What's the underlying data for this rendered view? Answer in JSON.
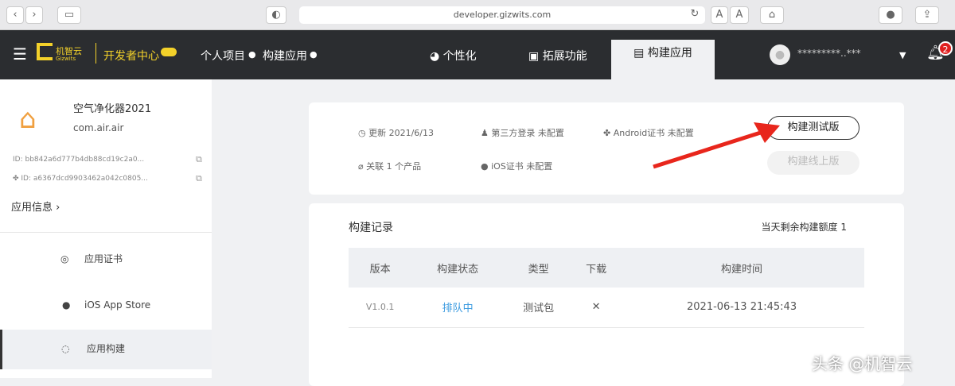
{
  "browser": {
    "url": "developer.gizwits.com",
    "font_small": "A",
    "font_large": "A"
  },
  "nav": {
    "brand": "机智云",
    "brand_sub": "Gizwits",
    "section": "开发者中心",
    "breadcrumb": [
      "个人项目",
      "构建应用"
    ],
    "tabs": [
      {
        "label": "个性化"
      },
      {
        "label": "拓展功能"
      },
      {
        "label": "构建应用"
      }
    ],
    "user": "*********..***",
    "notifications": "2"
  },
  "app": {
    "name": "空气净化器2021",
    "package": "com.air.air",
    "ios_id": "ID: bb842a6d777b4db88cd19c2a0...",
    "android_id": "ID: a6367dcd9903462a042c0805...",
    "info_link": "应用信息"
  },
  "sidebar": {
    "items": [
      {
        "label": "应用证书"
      },
      {
        "label": "iOS App Store"
      },
      {
        "label": "应用构建"
      }
    ]
  },
  "summary": {
    "updated": "更新 2021/6/13",
    "third_party": "第三方登录 未配置",
    "android_cert": "Android证书 未配置",
    "related": "关联 1 个产品",
    "ios_cert": "iOS证书 未配置",
    "build_test": "构建测试版",
    "build_release": "构建线上版"
  },
  "records": {
    "title": "构建记录",
    "quota": "当天剩余构建额度 1",
    "columns": [
      "版本",
      "构建状态",
      "类型",
      "下载",
      "构建时间"
    ],
    "rows": [
      {
        "version": "V1.0.1",
        "status": "排队中",
        "type": "测试包",
        "time": "2021-06-13 21:45:43"
      }
    ]
  },
  "watermark": "头条 @机智云"
}
